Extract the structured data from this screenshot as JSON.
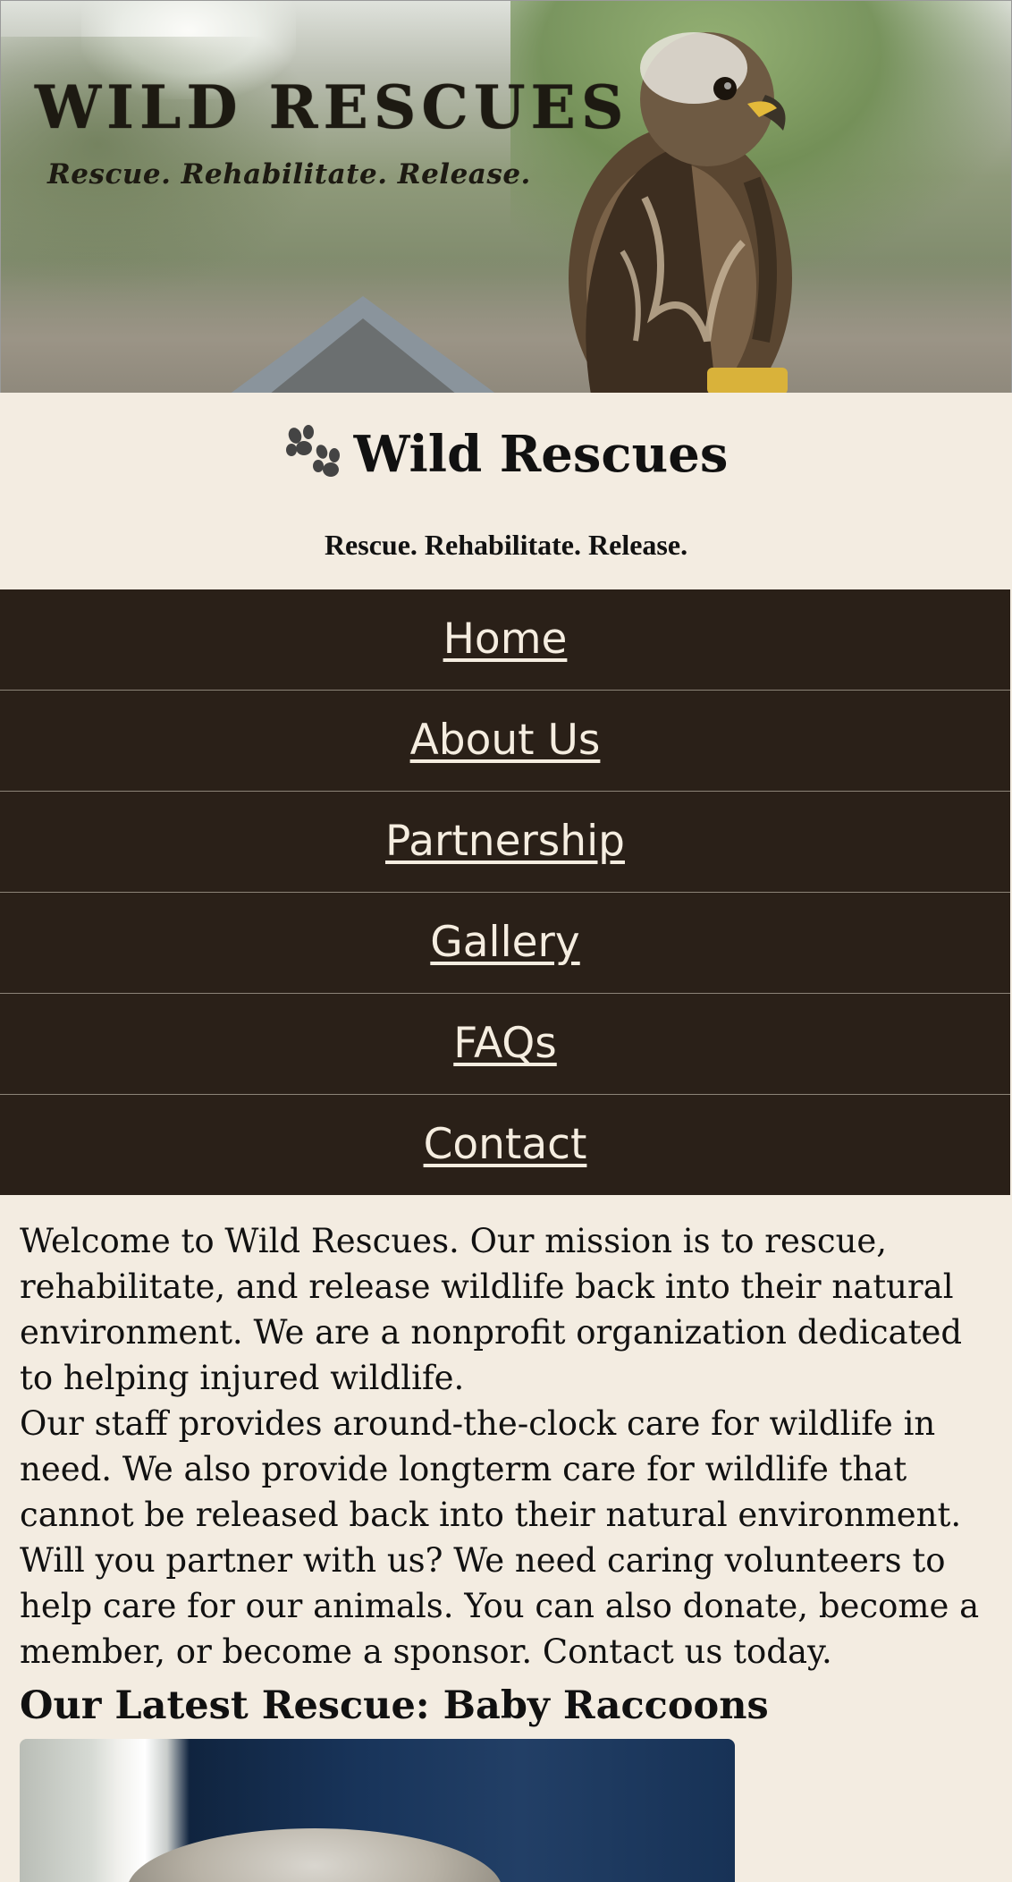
{
  "hero": {
    "title": "WILD RESCUES",
    "tagline": "Rescue. Rehabilitate. Release."
  },
  "header": {
    "brand": "Wild Rescues",
    "slogan": "Rescue. Rehabilitate. Release."
  },
  "nav": {
    "items": [
      {
        "label": "Home"
      },
      {
        "label": "About Us"
      },
      {
        "label": "Partnership"
      },
      {
        "label": "Gallery"
      },
      {
        "label": "FAQs"
      },
      {
        "label": "Contact"
      }
    ]
  },
  "main": {
    "paragraphs": [
      "Welcome to Wild Rescues. Our mission is to rescue, rehabilitate, and release wildlife back into their natural environment. We are a nonprofit organization dedicated to helping injured wildlife.",
      "Our staff provides around-the-clock care for wildlife in need. We also provide longterm care for wildlife that cannot be released back into their natural environment.",
      "Will you partner with us? We need caring volunteers to help care for our animals. You can also donate, become a member, or become a sponsor. Contact us today."
    ],
    "latest_heading": "Our Latest Rescue: Baby Raccoons"
  },
  "colors": {
    "background": "#f3ece1",
    "nav_background": "#2a2018",
    "nav_text": "#f5ede0"
  },
  "icons": {
    "brand": "paw-icon"
  }
}
